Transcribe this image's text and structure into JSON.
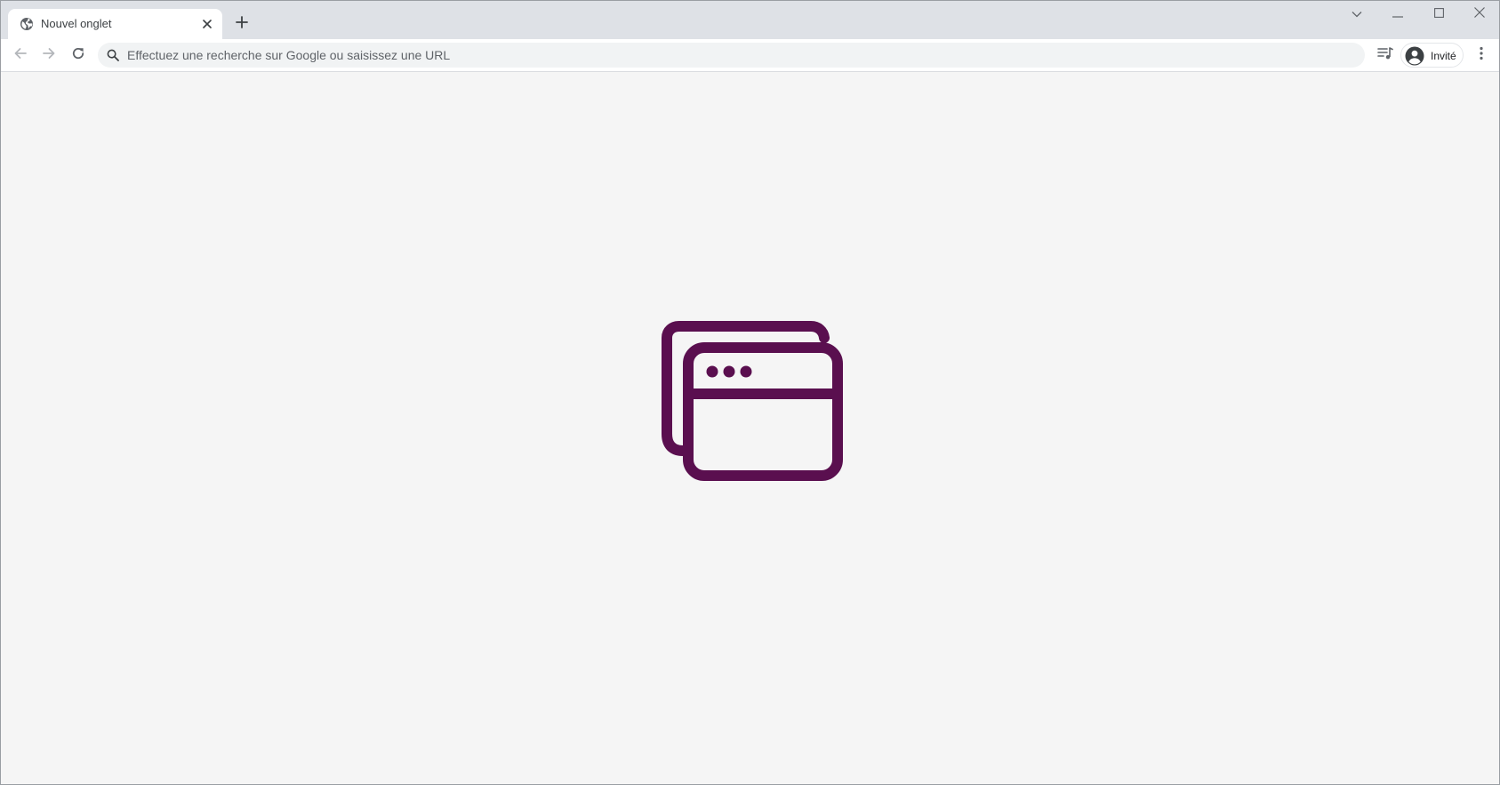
{
  "tab": {
    "title": "Nouvel onglet",
    "favicon": "globe-icon"
  },
  "tabstrip": {
    "new_tab_icon": "plus-icon",
    "tab_search_icon": "chevron-down-icon"
  },
  "window_controls": {
    "minimize_icon": "minimize-icon",
    "maximize_icon": "maximize-icon",
    "close_icon": "close-icon"
  },
  "toolbar": {
    "back_icon": "arrow-left-icon",
    "forward_icon": "arrow-right-icon",
    "reload_icon": "reload-icon",
    "omnibox": {
      "placeholder": "Effectuez une recherche sur Google ou saisissez une URL",
      "value": "",
      "icon": "search-icon"
    },
    "reading_list_icon": "reading-list-icon",
    "profile": {
      "label": "Invité",
      "icon": "account-circle-icon"
    },
    "menu_icon": "more-vert-icon"
  },
  "content": {
    "illustration": "browser-windows-icon",
    "illustration_color": "#5a0f4f"
  },
  "colors": {
    "tabstrip_bg": "#dee1e6",
    "toolbar_bg": "#ffffff",
    "omnibox_bg": "#f1f3f4",
    "content_bg": "#f5f5f5",
    "icon_color": "#5f6368"
  }
}
